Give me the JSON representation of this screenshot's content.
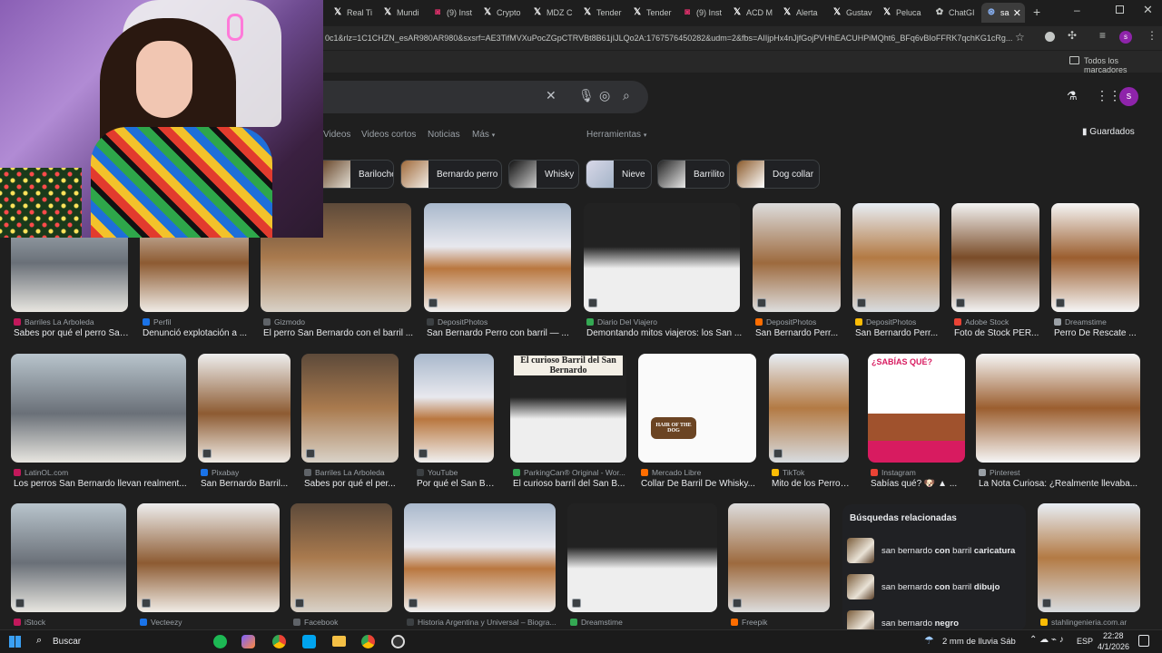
{
  "tabs": [
    {
      "label": "Real Ti",
      "icon": "x-icon"
    },
    {
      "label": "Mundi",
      "icon": "x-icon"
    },
    {
      "label": "(9) Inst",
      "icon": "instagram-icon"
    },
    {
      "label": "Crypto",
      "icon": "x-icon"
    },
    {
      "label": "MDZ C",
      "icon": "x-icon"
    },
    {
      "label": "Tender",
      "icon": "x-icon"
    },
    {
      "label": "Tender",
      "icon": "x-icon"
    },
    {
      "label": "(9) Inst",
      "icon": "instagram-icon"
    },
    {
      "label": "ACD M",
      "icon": "x-icon"
    },
    {
      "label": "Alerta",
      "icon": "x-icon"
    },
    {
      "label": "Gustav",
      "icon": "x-icon"
    },
    {
      "label": "Peluca",
      "icon": "x-icon"
    },
    {
      "label": "ChatGI",
      "icon": "chatgpt-icon"
    },
    {
      "label": "sa",
      "icon": "google-icon"
    }
  ],
  "address_url": "0c1&rlz=1C1CHZN_esAR980AR980&sxsrf=AE3TifMVXuPocZGpCTRVBt8B61jIJLQo2A:1767576450282&udm=2&fbs=AIIjpHx4nJjfGojPVHhEACUHPiMQht6_BFq6vBIoFFRK7qchKG1cRg...",
  "bookmarks_label": "Todos los marcadores",
  "profile_initial": "s",
  "nav": {
    "videos": "Videos",
    "shorts": "Videos cortos",
    "news": "Noticias",
    "more": "Más",
    "tools": "Herramientas",
    "saved": "Guardados"
  },
  "chips": [
    "Bariloche",
    "Bernardo perro",
    "Whisky",
    "Nieve",
    "Barrilito",
    "Dog collar"
  ],
  "results_row1": [
    {
      "source": "Barriles La Arboleda",
      "title": "Sabes por qué el perro San ..."
    },
    {
      "source": "Perfil",
      "title": "Denunció explotación a ..."
    },
    {
      "source": "Gizmodo",
      "title": "El perro San Bernardo con el barril ..."
    },
    {
      "source": "DepositPhotos",
      "title": "San Bernardo Perro con barril — ..."
    },
    {
      "source": "Diario Del Viajero",
      "title": "Demontando mitos viajeros: los San ..."
    },
    {
      "source": "DepositPhotos",
      "title": "San Bernardo Perr..."
    },
    {
      "source": "DepositPhotos",
      "title": "San Bernardo Perr..."
    },
    {
      "source": "Adobe Stock",
      "title": "Foto de Stock PER..."
    },
    {
      "source": "Dreamstime",
      "title": "Perro De Rescate ..."
    }
  ],
  "results_row2": [
    {
      "source": "LatinOL.com",
      "title": "Los perros San Bernardo llevan realment..."
    },
    {
      "source": "Pixabay",
      "title": "San Bernardo Barril..."
    },
    {
      "source": "Barriles La Arboleda",
      "title": "Sabes por qué el per..."
    },
    {
      "source": "YouTube",
      "title": "Por qué el San Ber..."
    },
    {
      "source": "ParkingCan® Original - Wor...",
      "title": "El curioso barril del San B..."
    },
    {
      "source": "Mercado Libre",
      "title": "Collar De Barril De Whisky..."
    },
    {
      "source": "TikTok",
      "title": "Mito de los Perros ..."
    },
    {
      "source": "Instagram",
      "title": "Sabías qué? 🐶 ▲ ..."
    },
    {
      "source": "Pinterest",
      "title": "La Nota Curiosa: ¿Realmente llevaba..."
    }
  ],
  "results_row3": [
    {
      "source": "iStock"
    },
    {
      "source": "Vecteezy"
    },
    {
      "source": "Facebook"
    },
    {
      "source": "Historia Argentina y Universal – Biogra..."
    },
    {
      "source": "Dreamstime"
    },
    {
      "source": "Freepik"
    },
    {
      "source": "stahlingenieria.com.ar"
    }
  ],
  "image_texts": {
    "curioso": "El curioso Barril del San Bernardo",
    "sabias": "¿SABÍAS QUÉ?",
    "barrel": "HAIR OF THE DOG"
  },
  "related": {
    "title": "Búsquedas relacionadas",
    "items": [
      {
        "pre": "san bernardo ",
        "b1": "con",
        "mid": " barril ",
        "b2": "caricatura"
      },
      {
        "pre": "san bernardo ",
        "b1": "con",
        "mid": " barril ",
        "b2": "dibujo"
      },
      {
        "pre": "san bernardo ",
        "b1": "negro",
        "mid": "",
        "b2": ""
      }
    ]
  },
  "taskbar": {
    "search": "Buscar",
    "weather": "2 mm de lluvia Sáb",
    "lang": "ESP",
    "time": "22:28",
    "date": "4/1/2026"
  },
  "colors": {
    "bg": "#1f1f1f",
    "accent": "#8ab4f8",
    "avatar": "#8e24aa"
  }
}
